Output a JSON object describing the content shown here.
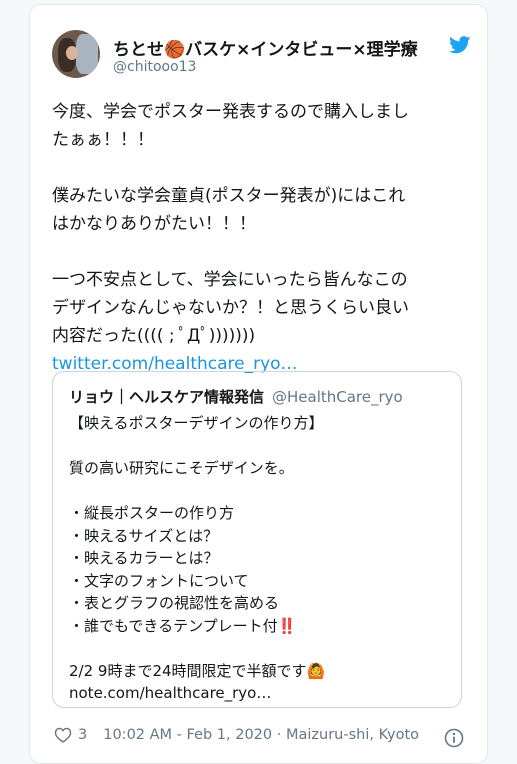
{
  "tweet": {
    "author_name": "ちとせ🏀バスケ×インタビュー×理学療",
    "author_handle": "@chitooo13",
    "body_lines": [
      "今度、学会でポスター発表するので購入しまし",
      "たぁぁ！！！",
      "",
      "僕みたいな学会童貞(ポスター発表が)にはこれ",
      "はかなりありがたい！！！",
      "",
      "一つ不安点として、学会にいったら皆んなこの",
      "デザインなんじゃないか？！と思うくらい良い",
      "内容だった(((( ; ﾟДﾟ)))))))"
    ],
    "link_text": "twitter.com/healthcare_ryo…"
  },
  "quoted": {
    "author_name": "リョウ｜ヘルスケア情報発信",
    "author_handle": "@HealthCare_ryo",
    "lines": [
      "【映えるポスターデザインの作り方】",
      "",
      "質の高い研究にこそデザインを。",
      "",
      "・縦長ポスターの作り方",
      "・映えるサイズとは？",
      "・映えるカラーとは？",
      "・文字のフォントについて",
      "・表とグラフの視認性を高める",
      "・誰でもできるテンプレート付‼️",
      "",
      "2/2  9時まで24時間限定で半額です🙆",
      "note.com/healthcare_ryo…"
    ]
  },
  "footer": {
    "like_count": "3",
    "timestamp": "10:02 AM - Feb 1, 2020 · Maizuru-shi, Kyoto"
  },
  "icons": {
    "brand": "twitter-bird-icon",
    "like": "heart-icon",
    "info": "info-icon"
  },
  "colors": {
    "brand": "#1da1f2",
    "link": "#1b95e0",
    "secondary_text": "#657786"
  }
}
